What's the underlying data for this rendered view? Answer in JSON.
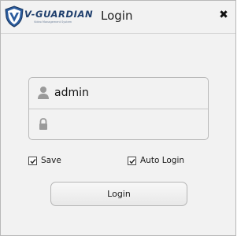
{
  "window": {
    "title": "Login",
    "logo_text": "V-GUARDIAN",
    "logo_subtitle": "Video Management System"
  },
  "form": {
    "username": {
      "value": "admin",
      "icon": "user-icon"
    },
    "password": {
      "value": "",
      "icon": "lock-icon"
    },
    "save": {
      "label": "Save",
      "checked": true
    },
    "auto_login": {
      "label": "Auto Login",
      "checked": true
    },
    "submit_label": "Login"
  },
  "colors": {
    "background": "#f2f2f2",
    "logo_blue": "#1f3f6d",
    "icon_gray": "#9a9a9a",
    "border": "#b9b9b9"
  }
}
